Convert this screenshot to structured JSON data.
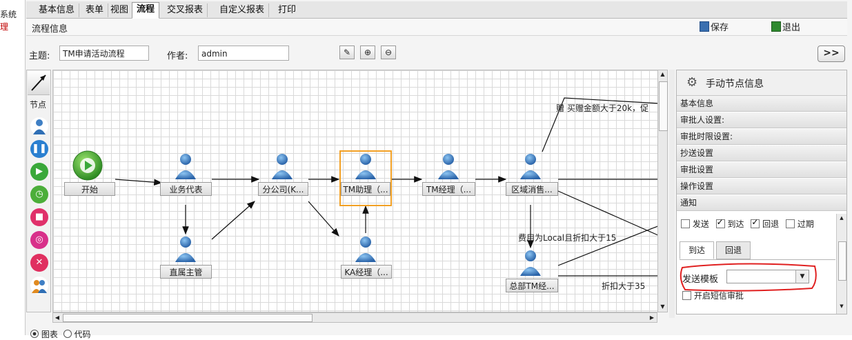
{
  "left_nav": {
    "items": [
      "系统",
      "理"
    ]
  },
  "tabs": [
    {
      "label": "基本信息"
    },
    {
      "label": "表单"
    },
    {
      "label": "视图"
    },
    {
      "label": "流程"
    },
    {
      "label": "交叉报表"
    },
    {
      "label": "自定义报表"
    },
    {
      "label": "打印"
    }
  ],
  "header": {
    "title": "流程信息",
    "save_label": "保存",
    "exit_label": "退出"
  },
  "form": {
    "subject_label": "主题:",
    "subject_value": "TM申请活动流程",
    "author_label": "作者:",
    "author_value": "admin",
    "more_button": ">>"
  },
  "palette": {
    "title": "节点"
  },
  "nodes": [
    {
      "id": "start",
      "label": "开始",
      "type": "start"
    },
    {
      "id": "sales_rep",
      "label": "业务代表",
      "type": "person"
    },
    {
      "id": "branch",
      "label": "分公司(K...",
      "type": "person"
    },
    {
      "id": "tm_assistant",
      "label": "TM助理（...",
      "type": "person",
      "selected": true
    },
    {
      "id": "tm_manager",
      "label": "TM经理（...",
      "type": "person"
    },
    {
      "id": "region_sales",
      "label": "区域消售...",
      "type": "person"
    },
    {
      "id": "direct_super",
      "label": "直属主管",
      "type": "person"
    },
    {
      "id": "ka_manager",
      "label": "KA经理（...",
      "type": "person"
    },
    {
      "id": "hq_tm",
      "label": "总部TM经...",
      "type": "person"
    }
  ],
  "edge_labels": {
    "top_right": "赠 买赠金额大于20k，促",
    "mid_right": "费用为Local且折扣大于15",
    "bottom_right": "折扣大于35"
  },
  "right_panel": {
    "title": "手动节点信息",
    "sections": [
      "基本信息",
      "审批人设置:",
      "审批时限设置:",
      "抄送设置",
      "审批设置",
      "操作设置",
      "通知"
    ],
    "notify_options": [
      {
        "label": "发送",
        "checked": false
      },
      {
        "label": "到达",
        "checked": true
      },
      {
        "label": "回退",
        "checked": true
      },
      {
        "label": "过期",
        "checked": false
      }
    ],
    "subtabs": [
      {
        "label": "到达",
        "active": true
      },
      {
        "label": "回退",
        "active": false
      }
    ],
    "template_label": "发送模板",
    "template_value": "",
    "sms_label": "开启短信审批"
  },
  "bottom": {
    "options": [
      {
        "label": "图表",
        "checked": true
      },
      {
        "label": "代码",
        "checked": false
      }
    ]
  },
  "colors": {
    "selection": "#f2a024",
    "person_blue": "#2f6fb5",
    "annotation_red": "#e02020",
    "start_green": "#3aa83a"
  }
}
